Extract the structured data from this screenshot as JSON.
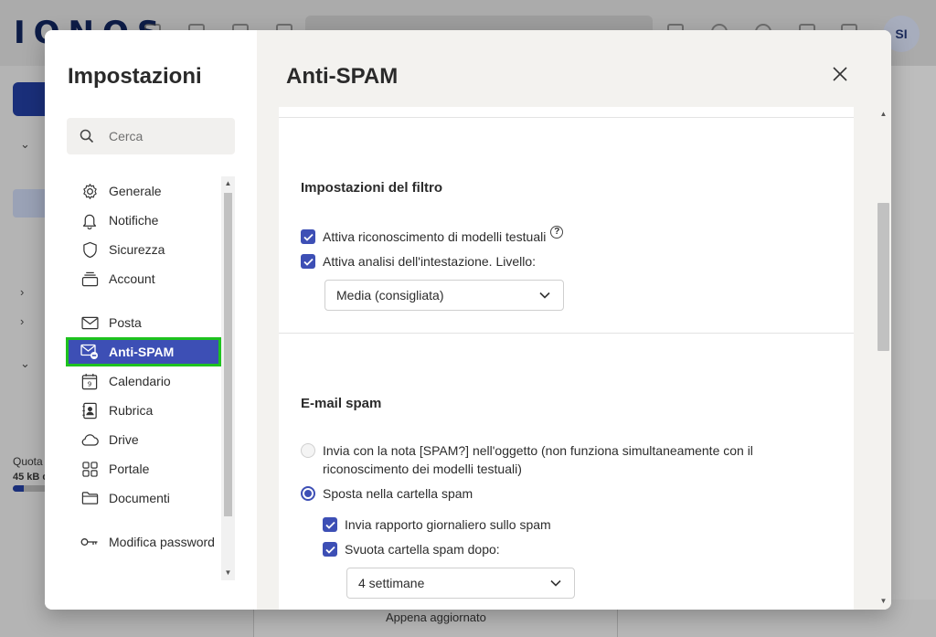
{
  "background_app": {
    "logo": "IONOS",
    "avatar_initials": "SI",
    "quota_label": "Quota",
    "quota_value": "45 kB c",
    "status_text": "Appena aggiornato",
    "quota_fill_fraction": 0.3
  },
  "settings": {
    "title": "Impostazioni",
    "search_placeholder": "Cerca",
    "nav": [
      {
        "label": "Generale",
        "icon": "gear-icon"
      },
      {
        "label": "Notifiche",
        "icon": "bell-icon"
      },
      {
        "label": "Sicurezza",
        "icon": "shield-icon"
      },
      {
        "label": "Account",
        "icon": "account-stack-icon"
      },
      {
        "label": "Posta",
        "icon": "mail-icon"
      },
      {
        "label": "Anti-SPAM",
        "icon": "mail-block-icon",
        "active": true
      },
      {
        "label": "Calendario",
        "icon": "calendar-icon",
        "day": "9"
      },
      {
        "label": "Rubrica",
        "icon": "contacts-icon"
      },
      {
        "label": "Drive",
        "icon": "cloud-icon"
      },
      {
        "label": "Portale",
        "icon": "grid-icon"
      },
      {
        "label": "Documenti",
        "icon": "folder-icon"
      },
      {
        "label": "Modifica password",
        "icon": "key-icon"
      }
    ]
  },
  "page": {
    "title": "Anti-SPAM",
    "filter_section": {
      "title": "Impostazioni del filtro",
      "opt_text_patterns": "Attiva riconoscimento di modelli testuali",
      "opt_header_analysis": "Attiva analisi dell'intestazione. Livello:",
      "level_select": "Media (consigliata)"
    },
    "spam_section": {
      "title": "E-mail spam",
      "radio_tag_line1": "Invia con la nota [SPAM?] nell'oggetto (non funziona simultaneamente con il",
      "radio_tag_line2": "riconoscimento dei modelli testuali)",
      "radio_move": "Sposta nella cartella spam",
      "opt_daily_report": "Invia rapporto giornaliero sullo spam",
      "opt_empty_folder": "Svuota cartella spam dopo:",
      "empty_after_select": "4 settimane"
    }
  }
}
